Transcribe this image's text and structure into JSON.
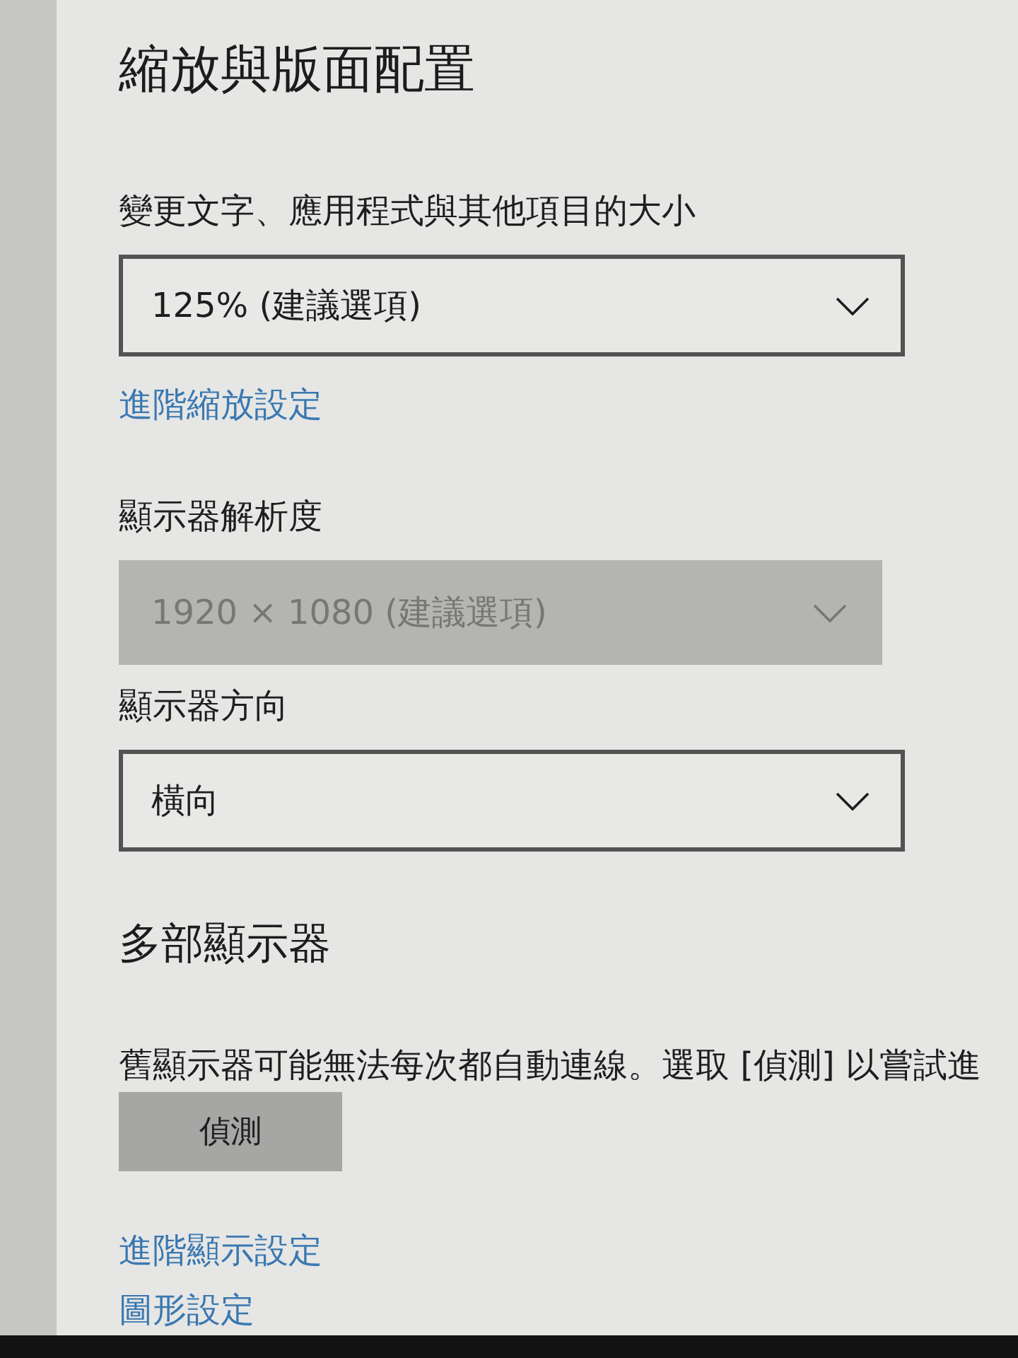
{
  "sections": [
    {
      "heading": "縮放與版面配置",
      "settings": [
        {
          "kind": "dropdown",
          "label": "變更文字、應用程式與其他項目的大小",
          "value": "125% (建議選項)",
          "disabled": false
        },
        {
          "kind": "link",
          "text": "進階縮放設定"
        },
        {
          "kind": "dropdown",
          "label": "顯示器解析度",
          "value": "1920 × 1080 (建議選項)",
          "disabled": true
        },
        {
          "kind": "dropdown",
          "label": "顯示器方向",
          "value": "橫向",
          "disabled": false
        }
      ]
    },
    {
      "heading": "多部顯示器",
      "settings": [
        {
          "kind": "text",
          "text": "舊顯示器可能無法每次都自動連線。選取 [偵測] 以嘗試進"
        },
        {
          "kind": "button",
          "text": "偵測"
        },
        {
          "kind": "link",
          "text": "進階顯示設定"
        },
        {
          "kind": "link",
          "text": "圖形設定"
        }
      ]
    }
  ]
}
